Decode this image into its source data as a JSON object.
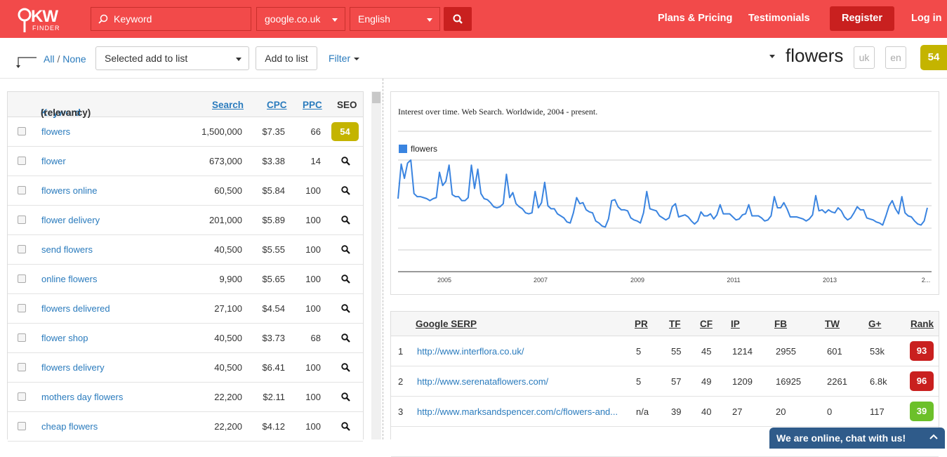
{
  "header": {
    "logo_kw": "KW",
    "logo_finder": "FINDER",
    "keyword_placeholder": "Keyword",
    "domain": "google.co.uk",
    "language": "English",
    "nav": [
      "Plans & Pricing",
      "Testimonials"
    ],
    "register": "Register",
    "login": "Log in"
  },
  "toolbar": {
    "all": "All",
    "sep": "/",
    "none": "None",
    "list_select": "Selected add to list",
    "add_to_list": "Add to list",
    "filter": "Filter",
    "keyword": "flowers",
    "loc": "uk",
    "lang": "en",
    "score": "54"
  },
  "keywords": {
    "headers": {
      "keyword": "Keyword",
      "relevancy": "(relevancy)",
      "search": "Search",
      "cpc": "CPC",
      "ppc": "PPC",
      "seo": "SEO"
    },
    "rows": [
      {
        "kw": "flowers",
        "search": "1,500,000",
        "cpc": "$7.35",
        "ppc": "66",
        "seo": "54"
      },
      {
        "kw": "flower",
        "search": "673,000",
        "cpc": "$3.38",
        "ppc": "14",
        "seo": ""
      },
      {
        "kw": "flowers online",
        "search": "60,500",
        "cpc": "$5.84",
        "ppc": "100",
        "seo": ""
      },
      {
        "kw": "flower delivery",
        "search": "201,000",
        "cpc": "$5.89",
        "ppc": "100",
        "seo": ""
      },
      {
        "kw": "send flowers",
        "search": "40,500",
        "cpc": "$5.55",
        "ppc": "100",
        "seo": ""
      },
      {
        "kw": "online flowers",
        "search": "9,900",
        "cpc": "$5.65",
        "ppc": "100",
        "seo": ""
      },
      {
        "kw": "flowers delivered",
        "search": "27,100",
        "cpc": "$4.54",
        "ppc": "100",
        "seo": ""
      },
      {
        "kw": "flower shop",
        "search": "40,500",
        "cpc": "$3.73",
        "ppc": "68",
        "seo": ""
      },
      {
        "kw": "flowers delivery",
        "search": "40,500",
        "cpc": "$6.41",
        "ppc": "100",
        "seo": ""
      },
      {
        "kw": "mothers day flowers",
        "search": "22,200",
        "cpc": "$2.11",
        "ppc": "100",
        "seo": ""
      },
      {
        "kw": "cheap flowers",
        "search": "22,200",
        "cpc": "$4.12",
        "ppc": "100",
        "seo": ""
      }
    ],
    "seo_color": "#c4b400"
  },
  "chart_data": {
    "type": "line",
    "title": "Interest over time. Web Search. Worldwide, 2004 - present.",
    "series": [
      {
        "name": "flowers",
        "color": "#3a84e0",
        "values": [
          62,
          96,
          82,
          97,
          100,
          67,
          64,
          64,
          63,
          62,
          60,
          62,
          63,
          88,
          75,
          79,
          95,
          66,
          64,
          64,
          60,
          60,
          63,
          95,
          72,
          91,
          67,
          62,
          61,
          58,
          54,
          53,
          54,
          57,
          86,
          63,
          68,
          57,
          54,
          52,
          48,
          47,
          48,
          69,
          53,
          58,
          78,
          55,
          52,
          52,
          47,
          45,
          43,
          39,
          38,
          48,
          63,
          57,
          58,
          51,
          49,
          48,
          40,
          38,
          35,
          34,
          42,
          60,
          61,
          54,
          51,
          51,
          50,
          43,
          41,
          40,
          38,
          48,
          69,
          52,
          51,
          50,
          45,
          43,
          41,
          43,
          54,
          57,
          44,
          45,
          46,
          44,
          40,
          37,
          40,
          49,
          45,
          45,
          47,
          42,
          46,
          56,
          47,
          47,
          47,
          44,
          41,
          42,
          46,
          47,
          56,
          45,
          45,
          45,
          43,
          40,
          41,
          45,
          64,
          53,
          53,
          58,
          52,
          44,
          44,
          44,
          43,
          42,
          40,
          42,
          46,
          65,
          50,
          51,
          48,
          51,
          49,
          48,
          53,
          50,
          44,
          41,
          43,
          48,
          54,
          51,
          51,
          43,
          42,
          41,
          39,
          38,
          36,
          45,
          55,
          60,
          52,
          47,
          64,
          48,
          45,
          44,
          40,
          37,
          36,
          40,
          53
        ]
      }
    ],
    "x_ticks": [
      "2005",
      "2007",
      "2009",
      "2011",
      "2013",
      "2..."
    ],
    "grid": true,
    "legend": "top-left"
  },
  "serp": {
    "headers": [
      "Google SERP",
      "PR",
      "TF",
      "CF",
      "IP",
      "FB",
      "TW",
      "G+",
      "Rank"
    ],
    "rows": [
      {
        "n": "1",
        "url": "http://www.interflora.co.uk/",
        "pr": "5",
        "tf": "55",
        "cf": "45",
        "ip": "1214",
        "fb": "2955",
        "tw": "601",
        "gp": "53k",
        "rank": "93",
        "rank_color": "#c9201f"
      },
      {
        "n": "2",
        "url": "http://www.serenataflowers.com/",
        "pr": "5",
        "tf": "57",
        "cf": "49",
        "ip": "1209",
        "fb": "16925",
        "tw": "2261",
        "gp": "6.8k",
        "rank": "96",
        "rank_color": "#c9201f"
      },
      {
        "n": "3",
        "url": "http://www.marksandspencer.com/c/flowers-and...",
        "pr": "n/a",
        "tf": "39",
        "cf": "40",
        "ip": "27",
        "fb": "20",
        "tw": "0",
        "gp": "117",
        "rank": "39",
        "rank_color": "#6cc02a"
      }
    ]
  },
  "chat": {
    "label": "We are online, chat with us!"
  },
  "colors": {
    "brand": "#f24a4a",
    "brand_dark": "#c9201f",
    "link": "#2a7bbd"
  }
}
